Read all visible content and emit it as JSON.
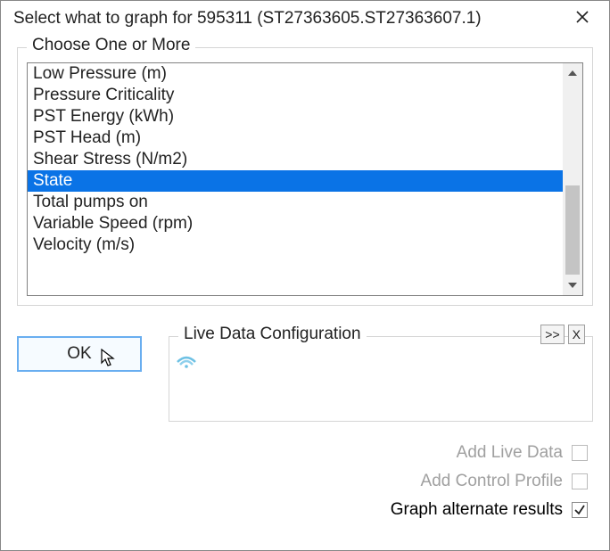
{
  "title": "Select what to graph for 595311 (ST27363605.ST27363607.1)",
  "group_label": "Choose One or More",
  "list": {
    "items": [
      "Low Pressure (m)",
      "Pressure Criticality",
      "PST Energy (kWh)",
      "PST Head (m)",
      "Shear Stress (N/m2)",
      "State",
      "Total pumps on",
      "Variable Speed (rpm)",
      "Velocity (m/s)"
    ],
    "selected_index": 5
  },
  "ok_label": "OK",
  "livedata": {
    "legend": "Live Data Configuration",
    "expand_label": ">>",
    "close_label": "X"
  },
  "checks": {
    "add_live_data": {
      "label": "Add Live Data",
      "checked": false,
      "enabled": false
    },
    "add_control_profile": {
      "label": "Add Control Profile",
      "checked": false,
      "enabled": false
    },
    "graph_alternate": {
      "label": "Graph alternate results",
      "checked": true,
      "enabled": true
    }
  }
}
